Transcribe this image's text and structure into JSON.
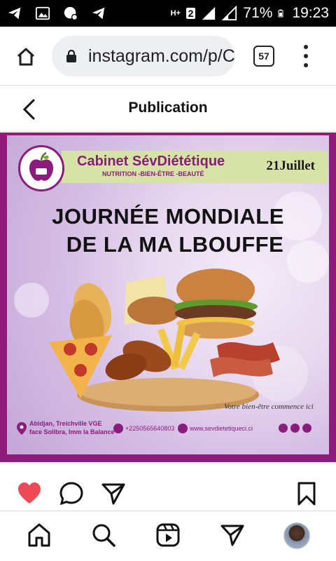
{
  "status_bar": {
    "battery": "71%",
    "time": "19:23",
    "network": "H+",
    "sim": "2",
    "notification_icons": [
      "telegram-icon",
      "gallery-icon",
      "message-icon",
      "telegram-icon"
    ]
  },
  "browser": {
    "url": "instagram.com/p/C",
    "tab_count": "57"
  },
  "instagram": {
    "page_title": "Publication"
  },
  "post": {
    "brand_name": "Cabinet SévDiététique",
    "brand_tagline": "NUTRITION -BIEN-ÊTRE -BEAUTÉ",
    "date": "21Juillet",
    "headline_line1": "JOURNÉE MONDIALE",
    "headline_line2": "DE LA MA LBOUFFE",
    "tagline": "Votre bien-être commence ici",
    "address_line1": "Abidjan, Treichville VGE",
    "address_line2": "face Solibra, Imm la Balance",
    "phone": "+2250565640803",
    "website": "www.sevdietetiqueci.ci",
    "colors": {
      "brand": "#8a1c7c",
      "band": "#d7e3a6",
      "border": "#8e1a7a"
    }
  },
  "actions": {
    "liked": true,
    "like_color": "#ed4956"
  }
}
